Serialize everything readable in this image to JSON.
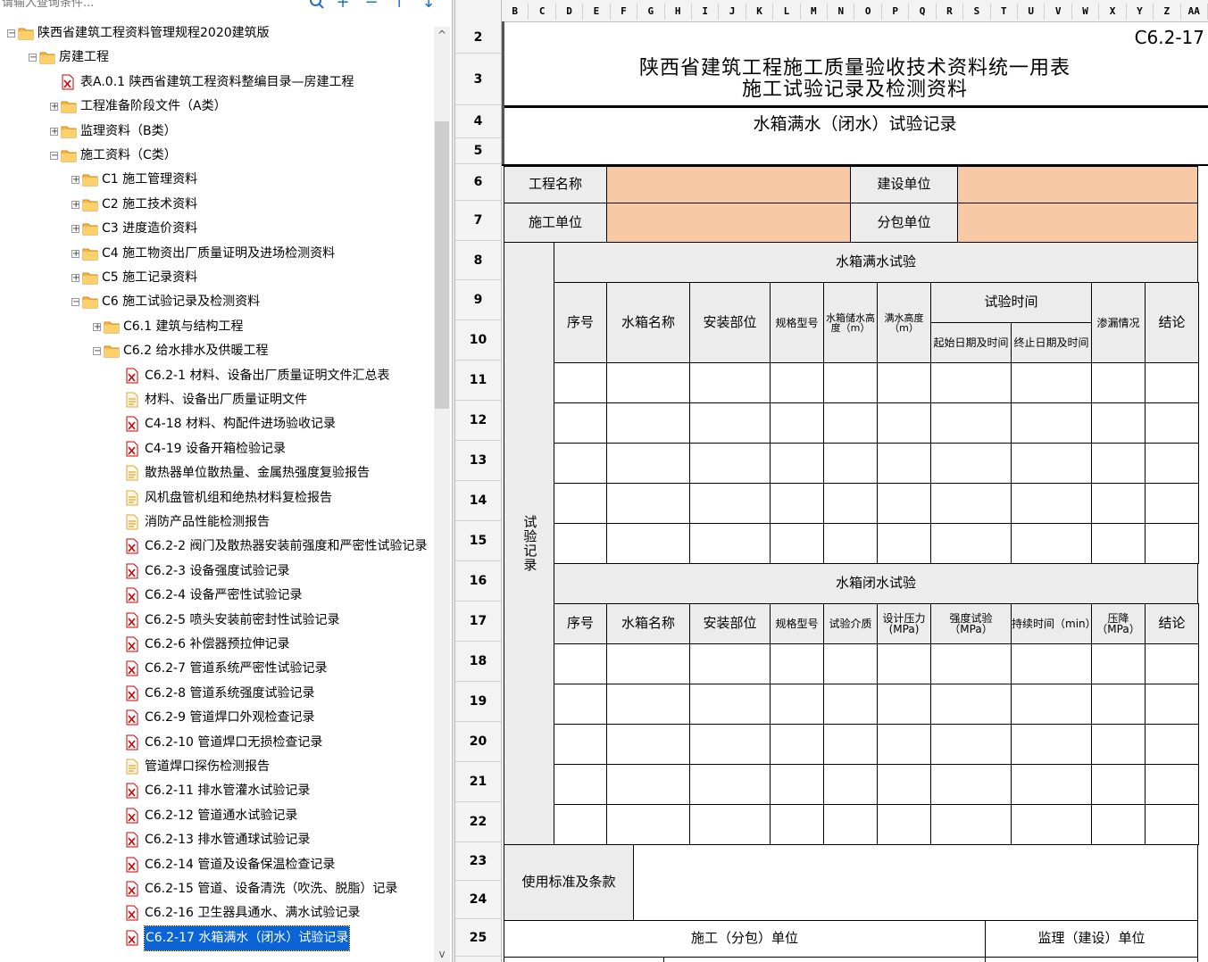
{
  "search": {
    "placeholder": "请输入查询条件..."
  },
  "toolbar": {
    "search_icon": "magnifier-icon",
    "add": "+",
    "remove": "−",
    "up": "↑",
    "down": "↓"
  },
  "tree": {
    "items": [
      {
        "level": 0,
        "type": "folder",
        "expander": "−",
        "label": "陕西省建筑工程资料管理规程2020建筑版"
      },
      {
        "level": 1,
        "type": "folder",
        "expander": "−",
        "label": "房建工程"
      },
      {
        "level": 2,
        "type": "pdf",
        "expander": "",
        "label": "表A.0.1 陕西省建筑工程资料整编目录—房建工程"
      },
      {
        "level": 2,
        "type": "folder",
        "expander": "+",
        "label": "工程准备阶段文件（A类）"
      },
      {
        "level": 2,
        "type": "folder",
        "expander": "+",
        "label": "监理资料（B类）"
      },
      {
        "level": 2,
        "type": "folder",
        "expander": "−",
        "label": "施工资料（C类）"
      },
      {
        "level": 3,
        "type": "folder",
        "expander": "+",
        "label": "C1 施工管理资料"
      },
      {
        "level": 3,
        "type": "folder",
        "expander": "+",
        "label": "C2 施工技术资料"
      },
      {
        "level": 3,
        "type": "folder",
        "expander": "+",
        "label": "C3 进度造价资料"
      },
      {
        "level": 3,
        "type": "folder",
        "expander": "+",
        "label": "C4 施工物资出厂质量证明及进场检测资料"
      },
      {
        "level": 3,
        "type": "folder",
        "expander": "+",
        "label": "C5 施工记录资料"
      },
      {
        "level": 3,
        "type": "folder",
        "expander": "−",
        "label": "C6 施工试验记录及检测资料"
      },
      {
        "level": 4,
        "type": "folder",
        "expander": "+",
        "label": "C6.1 建筑与结构工程"
      },
      {
        "level": 4,
        "type": "folder",
        "expander": "−",
        "label": "C6.2 给水排水及供暖工程"
      },
      {
        "level": 5,
        "type": "pdf",
        "expander": "",
        "label": "C6.2-1 材料、设备出厂质量证明文件汇总表"
      },
      {
        "level": 5,
        "type": "doc",
        "expander": "",
        "label": "材料、设备出厂质量证明文件"
      },
      {
        "level": 5,
        "type": "pdf",
        "expander": "",
        "label": "C4-18 材料、构配件进场验收记录"
      },
      {
        "level": 5,
        "type": "pdf",
        "expander": "",
        "label": "C4-19 设备开箱检验记录"
      },
      {
        "level": 5,
        "type": "doc",
        "expander": "",
        "label": "散热器单位散热量、金属热强度复验报告"
      },
      {
        "level": 5,
        "type": "doc",
        "expander": "",
        "label": "风机盘管机组和绝热材料复检报告"
      },
      {
        "level": 5,
        "type": "doc",
        "expander": "",
        "label": "消防产品性能检测报告"
      },
      {
        "level": 5,
        "type": "pdf",
        "expander": "",
        "label": "C6.2-2 阀门及散热器安装前强度和严密性试验记录"
      },
      {
        "level": 5,
        "type": "pdf",
        "expander": "",
        "label": "C6.2-3 设备强度试验记录"
      },
      {
        "level": 5,
        "type": "pdf",
        "expander": "",
        "label": "C6.2-4 设备严密性试验记录"
      },
      {
        "level": 5,
        "type": "pdf",
        "expander": "",
        "label": "C6.2-5 喷头安装前密封性试验记录"
      },
      {
        "level": 5,
        "type": "pdf",
        "expander": "",
        "label": "C6.2-6 补偿器预拉伸记录"
      },
      {
        "level": 5,
        "type": "pdf",
        "expander": "",
        "label": "C6.2-7 管道系统严密性试验记录"
      },
      {
        "level": 5,
        "type": "pdf",
        "expander": "",
        "label": "C6.2-8 管道系统强度试验记录"
      },
      {
        "level": 5,
        "type": "pdf",
        "expander": "",
        "label": "C6.2-9 管道焊口外观检查记录"
      },
      {
        "level": 5,
        "type": "pdf",
        "expander": "",
        "label": "C6.2-10 管道焊口无损检查记录"
      },
      {
        "level": 5,
        "type": "doc",
        "expander": "",
        "label": "管道焊口探伤检测报告"
      },
      {
        "level": 5,
        "type": "pdf",
        "expander": "",
        "label": "C6.2-11 排水管灌水试验记录"
      },
      {
        "level": 5,
        "type": "pdf",
        "expander": "",
        "label": "C6.2-12 管道通水试验记录"
      },
      {
        "level": 5,
        "type": "pdf",
        "expander": "",
        "label": "C6.2-13 排水管通球试验记录"
      },
      {
        "level": 5,
        "type": "pdf",
        "expander": "",
        "label": "C6.2-14 管道及设备保温检查记录"
      },
      {
        "level": 5,
        "type": "pdf",
        "expander": "",
        "label": "C6.2-15 管道、设备清洗（吹洗、脱脂）记录"
      },
      {
        "level": 5,
        "type": "pdf",
        "expander": "",
        "label": "C6.2-16 卫生器具通水、满水试验记录"
      },
      {
        "level": 5,
        "type": "pdf",
        "expander": "",
        "label": "C6.2-17 水箱满水（闭水）试验记录",
        "selected": true
      }
    ]
  },
  "sheet": {
    "columns": [
      "B",
      "C",
      "D",
      "E",
      "F",
      "G",
      "H",
      "I",
      "J",
      "K",
      "L",
      "M",
      "N",
      "O",
      "P",
      "Q",
      "R",
      "S",
      "T",
      "U",
      "V",
      "W",
      "X",
      "Y",
      "Z",
      "AA"
    ],
    "rows": [
      "2",
      "3",
      "4",
      "5",
      "6",
      "7",
      "8",
      "9",
      "10",
      "11",
      "12",
      "13",
      "14",
      "15",
      "16",
      "17",
      "18",
      "19",
      "20",
      "21",
      "22",
      "23",
      "24",
      "25"
    ],
    "form": {
      "code": "C6.2-17",
      "title_line1": "陕西省建筑工程施工质量验收技术资料统一用表",
      "title_line2": "施工试验记录及检测资料",
      "subtitle": "水箱满水（闭水）试验记录",
      "project_name_label": "工程名称",
      "construction_unit_label": "建设单位",
      "builder_label": "施工单位",
      "subcontractor_label": "分包单位",
      "section_vertical_label": "试验记录",
      "full_water_title": "水箱满水试验",
      "full_headers": {
        "seq": "序号",
        "tank_name": "水箱名称",
        "install_location": "安装部位",
        "spec_model": "规格型号",
        "storage_height": "水箱储水高度（m）",
        "full_height": "满水高度（m）",
        "test_time": "试验时间",
        "start": "起始日期及时间",
        "end": "终止日期及时间",
        "leakage": "渗漏情况",
        "conclusion": "结论"
      },
      "closed_water_title": "水箱闭水试验",
      "closed_headers": {
        "seq": "序号",
        "tank_name": "水箱名称",
        "install_location": "安装部位",
        "spec_model": "规格型号",
        "medium": "试验介质",
        "design_pressure": "设计压力(MPa)",
        "strength_test": "强度试验（MPa）",
        "duration": "持续时间（min）",
        "pressure_drop": "压降（MPa）",
        "conclusion": "结论"
      },
      "standard_label": "使用标准及条款",
      "builder_sub_label": "施工（分包）单位",
      "supervisor_label": "监理（建设）单位"
    }
  }
}
